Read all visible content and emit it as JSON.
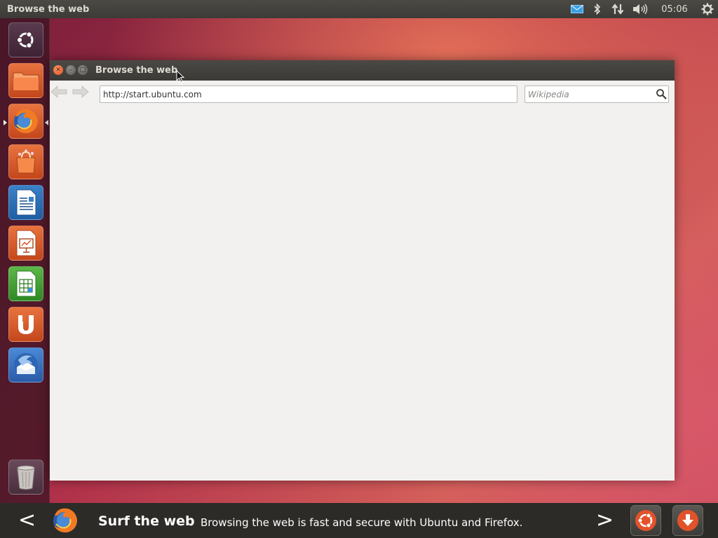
{
  "top_panel": {
    "title": "Browse the web",
    "clock": "05:06",
    "icons": [
      "mail-icon",
      "bluetooth-icon",
      "network-icon",
      "volume-icon",
      "gear-icon"
    ]
  },
  "launcher": {
    "items": [
      {
        "name": "dash-home",
        "icon": "ubuntu-logo-icon"
      },
      {
        "name": "files",
        "icon": "folder-icon"
      },
      {
        "name": "firefox",
        "icon": "firefox-icon",
        "running": true
      },
      {
        "name": "software-center",
        "icon": "shopping-bag-icon"
      },
      {
        "name": "libreoffice-writer",
        "icon": "writer-document-icon"
      },
      {
        "name": "libreoffice-impress",
        "icon": "impress-presentation-icon"
      },
      {
        "name": "libreoffice-calc",
        "icon": "calc-spreadsheet-icon"
      },
      {
        "name": "ubuntu-one",
        "icon": "ubuntu-one-icon"
      },
      {
        "name": "thunderbird",
        "icon": "thunderbird-icon"
      },
      {
        "name": "trash",
        "icon": "trash-icon"
      }
    ]
  },
  "window": {
    "title": "Browse the web",
    "url": "http://start.ubuntu.com",
    "search_placeholder": "Wikipedia"
  },
  "slideshow": {
    "title": "Surf the web",
    "text": "Browsing the web is fast and secure with Ubuntu and Firefox.",
    "prev_label": "<",
    "next_label": ">"
  },
  "colors": {
    "ubuntu_orange": "#dd4814",
    "panel": "#3c3b37"
  }
}
